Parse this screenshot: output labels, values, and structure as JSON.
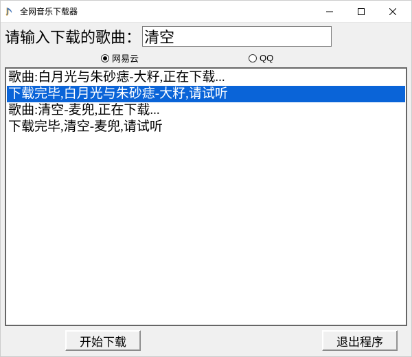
{
  "window": {
    "title": "全网音乐下载器"
  },
  "input": {
    "label": "请输入下载的歌曲：",
    "value": "清空"
  },
  "radios": {
    "netease": "网易云",
    "qq": "QQ",
    "selected": "netease"
  },
  "list": {
    "items": [
      {
        "text": "歌曲:白月光与朱砂痣-大籽,正在下载...",
        "selected": false
      },
      {
        "text": "下载完毕,白月光与朱砂痣-大籽,请试听",
        "selected": true
      },
      {
        "text": "歌曲:清空-麦兜,正在下载...",
        "selected": false
      },
      {
        "text": "下载完毕,清空-麦兜,请试听",
        "selected": false
      }
    ]
  },
  "buttons": {
    "download": "开始下载",
    "exit": "退出程序"
  }
}
